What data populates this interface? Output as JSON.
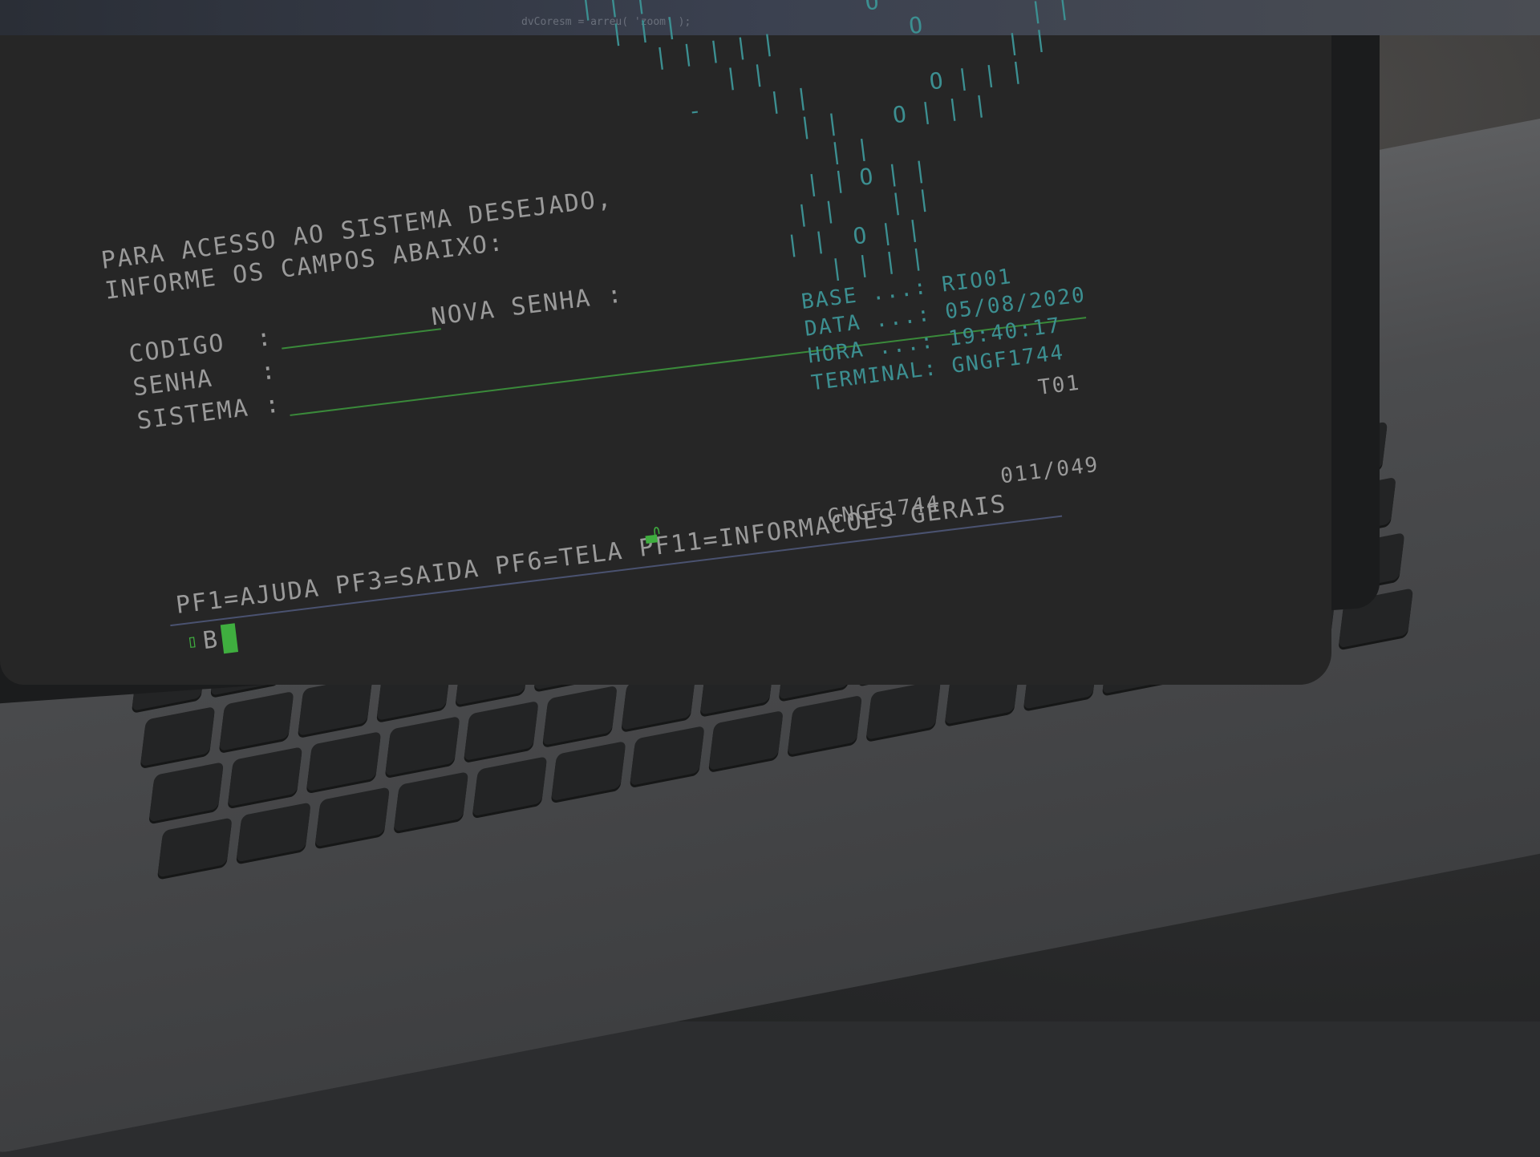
{
  "terminal": {
    "prompt_line1": "PARA ACESSO AO SISTEMA DESEJADO,",
    "prompt_line2": "INFORME OS CAMPOS ABAIXO:",
    "fields": {
      "codigo_label": "CODIGO  :",
      "senha_label": "SENHA   :",
      "sistema_label": "SISTEMA :",
      "nova_senha_label": "NOVA SENHA :"
    },
    "info": {
      "base": "BASE ...: RIO01",
      "data": "DATA ...: 05/08/2020",
      "hora": "HORA ...: 19:40:17",
      "terminal": "TERMINAL: GNGF1744"
    },
    "session_code": "T01",
    "status_terminal": "GNGF1744",
    "cursor_position": "011/049",
    "function_keys": "PF1=AJUDA PF3=SAIDA PF6=TELA PF11=INFORMACOES GERAIS",
    "status_prefix": "B",
    "ascii_art": [
      "   | | |                        O  | |",
      "     | | |              O     O  | |",
      "        | | | | |          O        | |",
      "             | |                  | |",
      "          -     | |         O | | |",
      "                  | |    O | | |",
      "                    | |   ",
      "                  | | O | |",
      "                 | |    | |",
      "                | |  O | |",
      "                   | | | |"
    ],
    "top_code_text": "dvCoresm = arreu( 'zoom' );"
  },
  "colors": {
    "screen_bg": "#262626",
    "text_gray": "#9a9a9a",
    "text_teal": "#3c8f91",
    "accent_green": "#3fae3f"
  }
}
